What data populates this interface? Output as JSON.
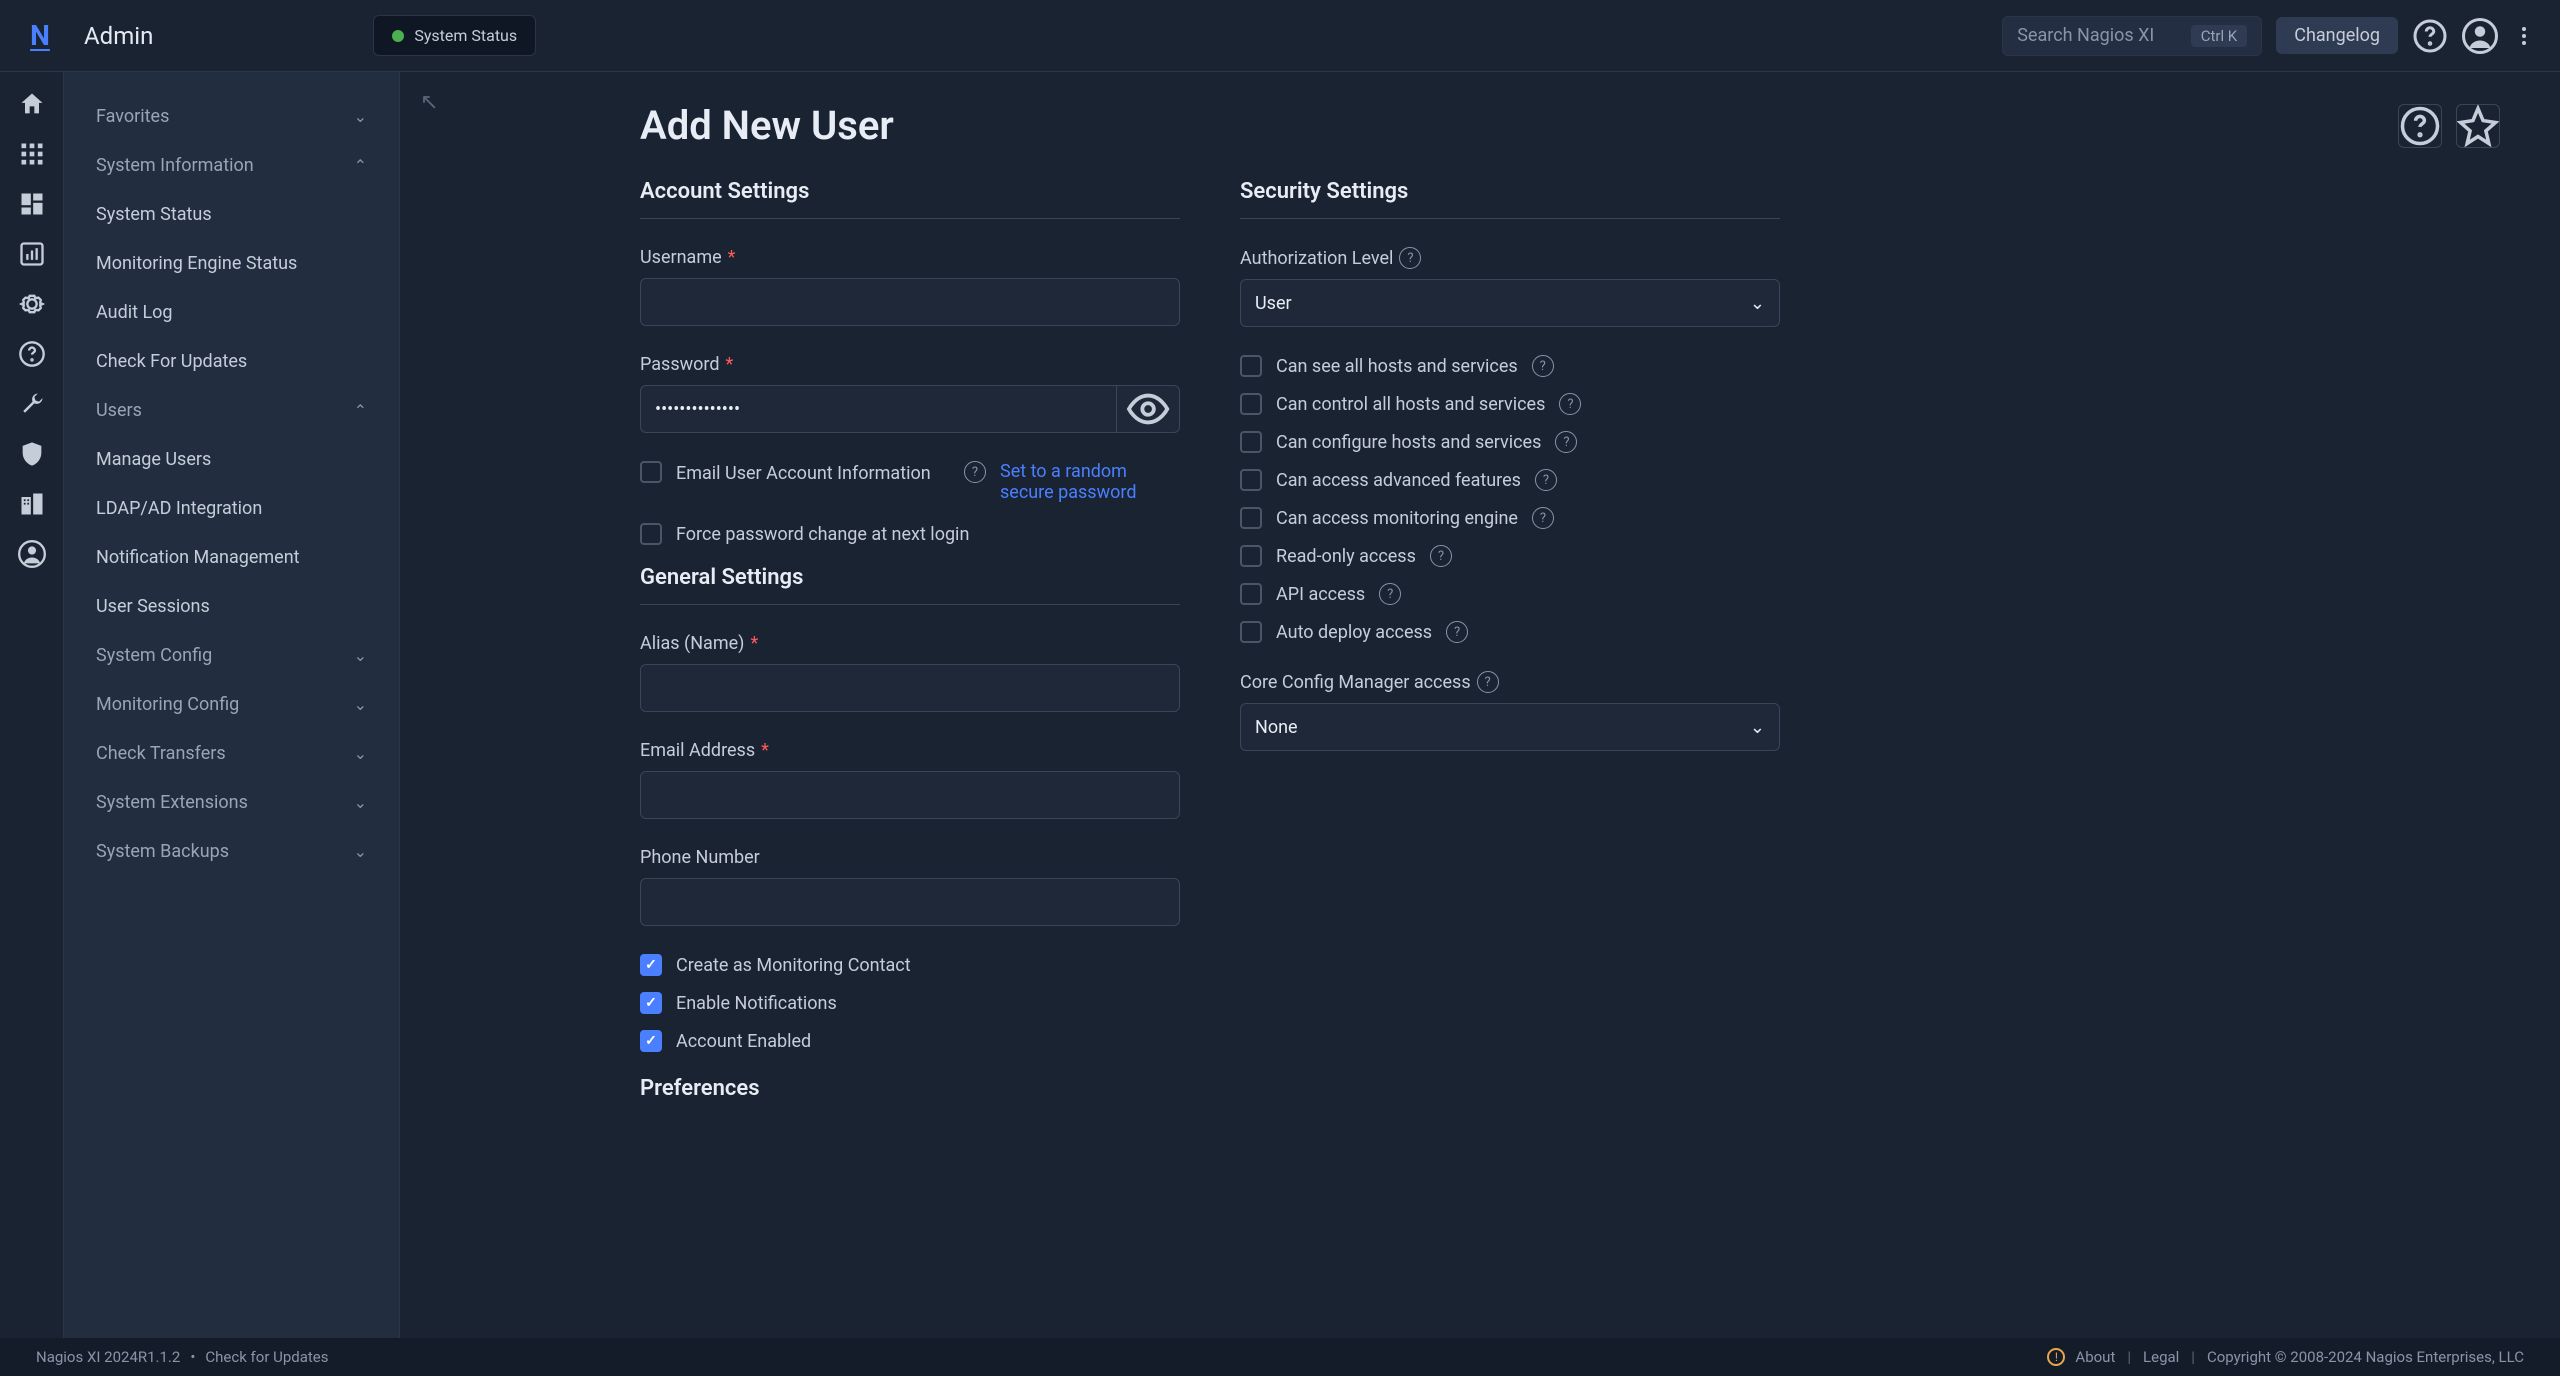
{
  "header": {
    "admin_title": "Admin",
    "system_status": "System Status",
    "search_placeholder": "Search Nagios XI",
    "kbd_hint": "Ctrl K",
    "changelog": "Changelog"
  },
  "sidebar": {
    "groups": {
      "favorites": "Favorites",
      "system_information": "System Information",
      "users": "Users",
      "system_config": "System Config",
      "monitoring_config": "Monitoring Config",
      "check_transfers": "Check Transfers",
      "system_extensions": "System Extensions",
      "system_backups": "System Backups"
    },
    "system_information_items": {
      "system_status": "System Status",
      "monitoring_engine_status": "Monitoring Engine Status",
      "audit_log": "Audit Log",
      "check_for_updates": "Check For Updates"
    },
    "users_items": {
      "manage_users": "Manage Users",
      "ldap_ad": "LDAP/AD Integration",
      "notification_management": "Notification Management",
      "user_sessions": "User Sessions"
    }
  },
  "page": {
    "title": "Add New User",
    "sections": {
      "account_settings": "Account Settings",
      "general_settings": "General Settings",
      "security_settings": "Security Settings",
      "preferences": "Preferences"
    },
    "fields": {
      "username": "Username",
      "password": "Password",
      "password_value": "••••••••••••••",
      "email_user_info": "Email User Account Information",
      "random_password_link": "Set to a random secure password",
      "force_password_change": "Force password change at next login",
      "alias": "Alias (Name)",
      "email": "Email Address",
      "phone": "Phone Number",
      "create_contact": "Create as Monitoring Contact",
      "enable_notifications": "Enable Notifications",
      "account_enabled": "Account Enabled",
      "auth_level": "Authorization Level",
      "auth_level_value": "User",
      "ccm_access": "Core Config Manager access",
      "ccm_access_value": "None"
    },
    "permissions": {
      "see_all": "Can see all hosts and services",
      "control_all": "Can control all hosts and services",
      "configure": "Can configure hosts and services",
      "advanced": "Can access advanced features",
      "monitoring_engine": "Can access monitoring engine",
      "readonly": "Read-only access",
      "api": "API access",
      "auto_deploy": "Auto deploy access"
    }
  },
  "footer": {
    "version": "Nagios XI 2024R1.1.2",
    "bullet": "•",
    "check_updates": "Check for Updates",
    "about": "About",
    "legal": "Legal",
    "copyright": "Copyright © 2008-2024 Nagios Enterprises, LLC"
  }
}
